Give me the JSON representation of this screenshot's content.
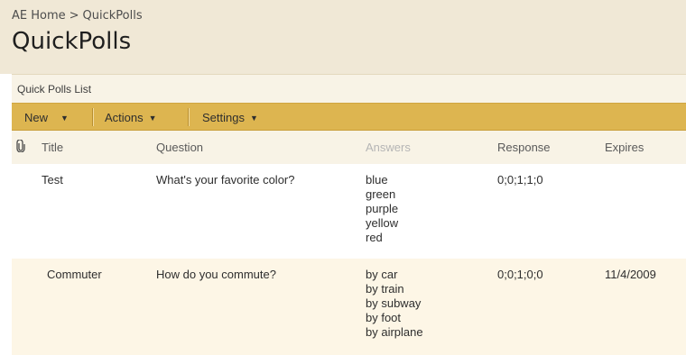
{
  "breadcrumb": {
    "home": "AE Home",
    "separator": ">",
    "current": "QuickPolls"
  },
  "page_title": "QuickPolls",
  "list_title": "Quick Polls List",
  "toolbar": {
    "new_label": "New",
    "actions_label": "Actions",
    "settings_label": "Settings"
  },
  "columns": {
    "attachments_icon": "paperclip-icon",
    "title": "Title",
    "question": "Question",
    "answers": "Answers",
    "response": "Response",
    "expires": "Expires"
  },
  "rows": [
    {
      "title": "Test",
      "question": "What's your favorite color?",
      "answers": [
        "blue",
        "green",
        "purple",
        "yellow",
        "red"
      ],
      "response": "0;0;1;1;0",
      "expires": ""
    },
    {
      "title": "Commuter",
      "question": "How do you commute?",
      "answers": [
        "by car",
        "by train",
        "by subway",
        "by foot",
        "by airplane"
      ],
      "response": "0;0;1;0;0",
      "expires": "11/4/2009"
    }
  ],
  "colors": {
    "header_band": "#f0e8d6",
    "toolbar": "#ddb550",
    "alt_row": "#fdf6e6"
  }
}
